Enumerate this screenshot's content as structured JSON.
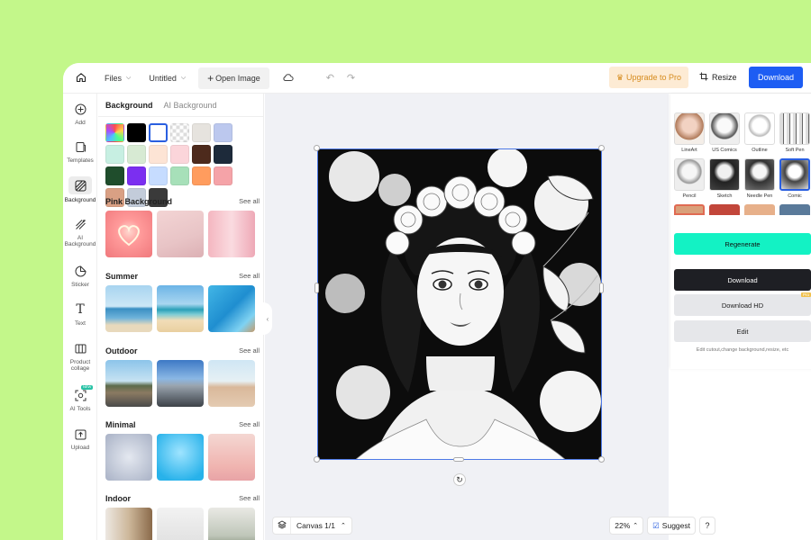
{
  "topbar": {
    "files_label": "Files",
    "untitled_label": "Untitled",
    "open_image_label": "Open Image",
    "upgrade_label": "Upgrade to Pro",
    "resize_label": "Resize",
    "download_label": "Download"
  },
  "rail": {
    "items": [
      {
        "label": "Add",
        "icon": "plus-circle-icon"
      },
      {
        "label": "Templates",
        "icon": "templates-icon"
      },
      {
        "label": "Background",
        "icon": "background-icon"
      },
      {
        "label": "AI Background",
        "icon": "ai-background-icon"
      },
      {
        "label": "Sticker",
        "icon": "sticker-icon"
      },
      {
        "label": "Text",
        "icon": "text-icon"
      },
      {
        "label": "Product collage",
        "icon": "collage-icon"
      },
      {
        "label": "AI Tools",
        "icon": "ai-tools-icon",
        "badge": "NEW"
      },
      {
        "label": "Upload",
        "icon": "upload-icon"
      }
    ]
  },
  "panel": {
    "tab_background": "Background",
    "tab_ai_background": "AI Background",
    "see_all": "See all",
    "sections": [
      {
        "title": "Pink Background"
      },
      {
        "title": "Summer"
      },
      {
        "title": "Outdoor"
      },
      {
        "title": "Minimal"
      },
      {
        "title": "Indoor"
      }
    ],
    "swatch_colors": [
      "rainbow",
      "#000000",
      "#ffffff",
      "checker",
      "#e6e3de",
      "#bcc8ee",
      "#c7efe2",
      "#d7ead3",
      "#fde4d5",
      "#fbd5da",
      "#4d2a1c",
      "#1d2a3a",
      "#1f4d2c",
      "#7b2ff0",
      "#c6dcff",
      "#a7e0b9",
      "#ff9c5e",
      "#f5a3a8",
      "#d9a084",
      "#c3ccda",
      "#3a3a3a"
    ]
  },
  "canvas": {
    "page_label": "Canvas 1/1",
    "zoom": "22%",
    "suggest_label": "Suggest",
    "help_label": "?"
  },
  "right": {
    "styles": [
      {
        "label": "LineArt"
      },
      {
        "label": "US Comics"
      },
      {
        "label": "Outline"
      },
      {
        "label": "Soft Pen"
      },
      {
        "label": "Pencil"
      },
      {
        "label": "Sketch"
      },
      {
        "label": "Needle Pen"
      },
      {
        "label": "Comic"
      }
    ],
    "regenerate_label": "Regenerate",
    "download_label": "Download",
    "download_hd_label": "Download HD",
    "pro_badge": "Pro",
    "edit_label": "Edit",
    "hint": "Edit cutout,change background,resize, etc"
  },
  "colors": {
    "accent": "#1d5df3",
    "regenerate": "#13f2c4",
    "page_bg": "#c3f78a",
    "upgrade_text": "#d68c1f"
  }
}
